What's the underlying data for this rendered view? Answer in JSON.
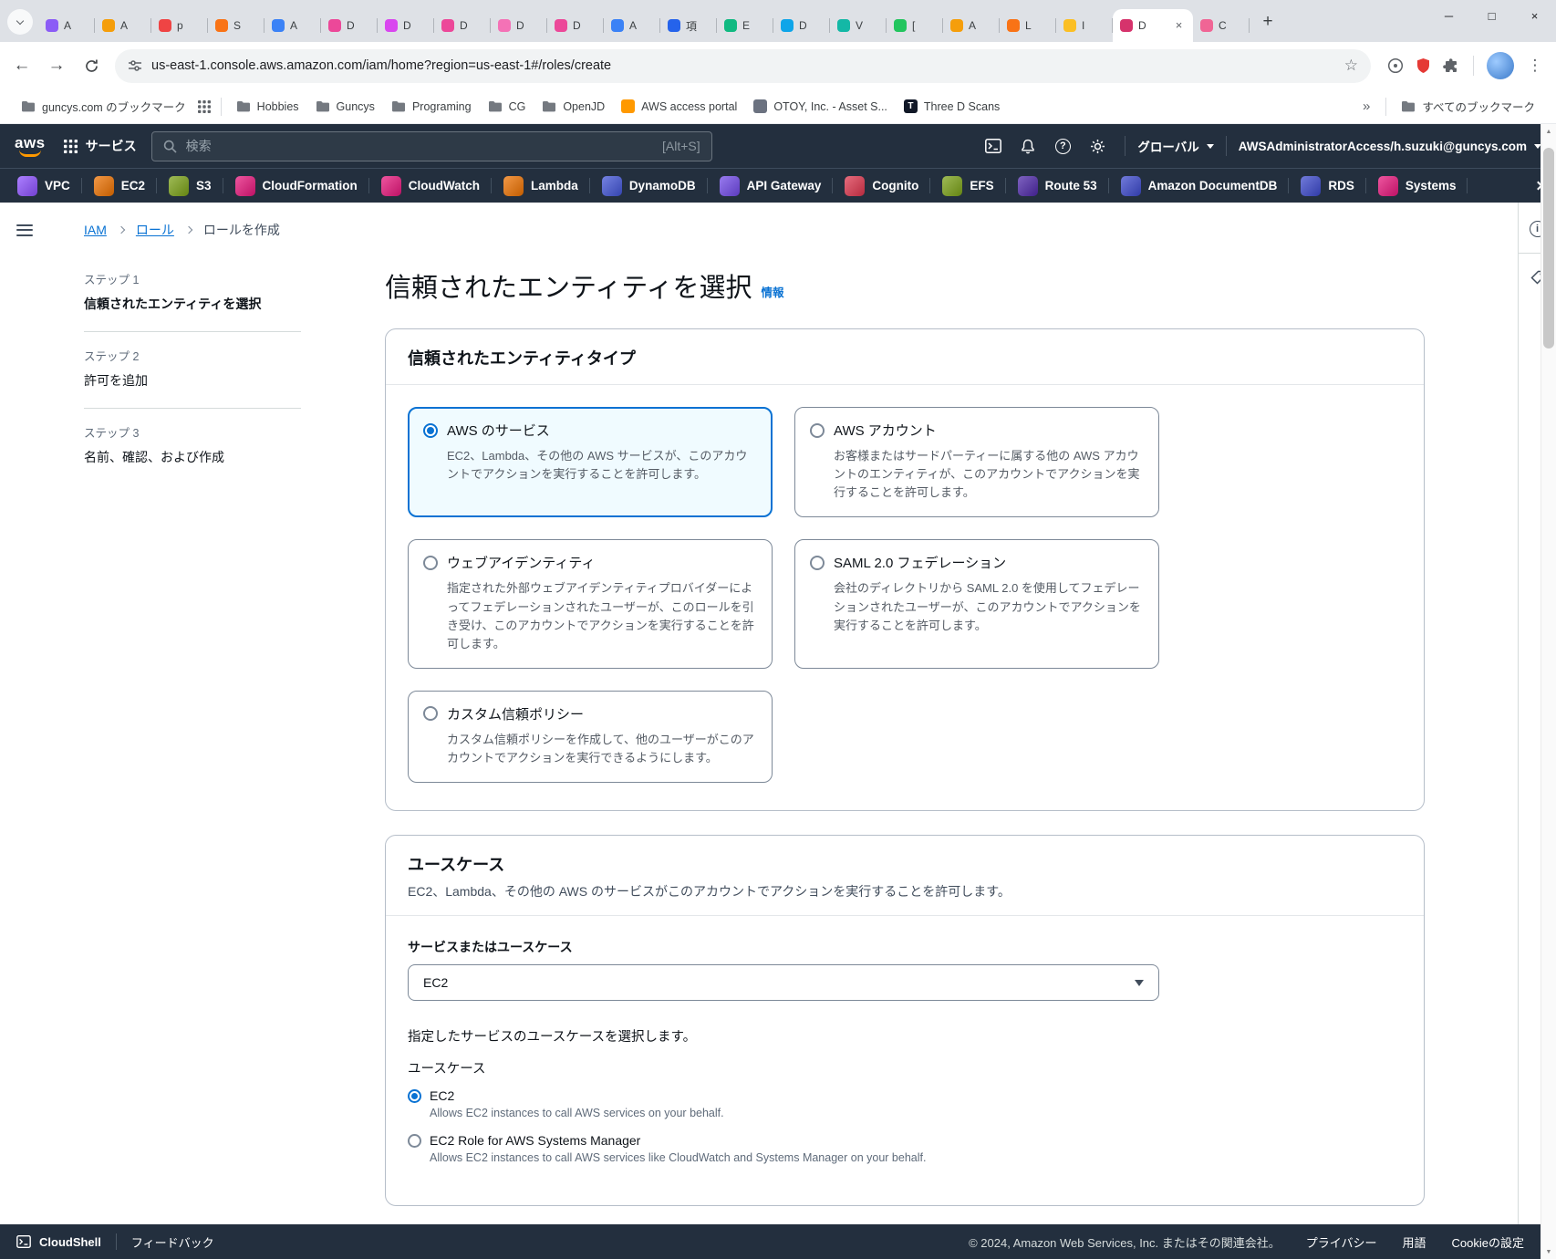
{
  "browser": {
    "tabs": [
      {
        "label": "A",
        "color": "#8b5cf6"
      },
      {
        "label": "A",
        "color": "#f59e0b"
      },
      {
        "label": "p",
        "color": "#ef4444"
      },
      {
        "label": "S",
        "color": "#f97316"
      },
      {
        "label": "A",
        "color": "#3b82f6"
      },
      {
        "label": "D",
        "color": "#ec4899"
      },
      {
        "label": "D",
        "color": "#d946ef"
      },
      {
        "label": "D",
        "color": "#ec4899"
      },
      {
        "label": "D",
        "color": "#f472b6"
      },
      {
        "label": "D",
        "color": "#ec4899"
      },
      {
        "label": "A",
        "color": "#3b82f6"
      },
      {
        "label": "項",
        "color": "#2563eb"
      },
      {
        "label": "E",
        "color": "#10b981"
      },
      {
        "label": "D",
        "color": "#0ea5e9"
      },
      {
        "label": "V",
        "color": "#14b8a6"
      },
      {
        "label": "[",
        "color": "#22c55e"
      },
      {
        "label": "A",
        "color": "#f59e0b"
      },
      {
        "label": "L",
        "color": "#f97316"
      },
      {
        "label": "I",
        "color": "#fbbf24"
      },
      {
        "label": "D",
        "color": "#d6336c",
        "active": true
      },
      {
        "label": "C",
        "color": "#f06595"
      }
    ],
    "url": "us-east-1.console.aws.amazon.com/iam/home?region=us-east-1#/roles/create",
    "bookmark_root": {
      "label": "guncys.com のブックマーク"
    },
    "bookmarks": [
      {
        "label": "Hobbies",
        "folder": true
      },
      {
        "label": "Guncys",
        "folder": true
      },
      {
        "label": "Programing",
        "folder": true
      },
      {
        "label": "CG",
        "folder": true
      },
      {
        "label": "OpenJD",
        "folder": true
      },
      {
        "label": "AWS access portal",
        "color": "#FF9900"
      },
      {
        "label": "OTOY, Inc. - Asset S...",
        "color": "#6b7280"
      },
      {
        "label": "Three D Scans",
        "color": "#111827",
        "letter": "T"
      }
    ],
    "all_bookmarks_label": "すべてのブックマーク"
  },
  "aws_header": {
    "services_label": "サービス",
    "search_placeholder": "検索",
    "search_shortcut": "[Alt+S]",
    "region": "グローバル",
    "account": "AWSAdministratorAccess/h.suzuki@guncys.com"
  },
  "services_bar": {
    "items": [
      {
        "label": "VPC",
        "color": "#8C4FFF"
      },
      {
        "label": "EC2",
        "color": "#ED7100"
      },
      {
        "label": "S3",
        "color": "#7AA116"
      },
      {
        "label": "CloudFormation",
        "color": "#E7157B"
      },
      {
        "label": "CloudWatch",
        "color": "#E7157B"
      },
      {
        "label": "Lambda",
        "color": "#ED7100"
      },
      {
        "label": "DynamoDB",
        "color": "#4053D6"
      },
      {
        "label": "API Gateway",
        "color": "#7048E8"
      },
      {
        "label": "Cognito",
        "color": "#DD344C"
      },
      {
        "label": "EFS",
        "color": "#7AA116"
      },
      {
        "label": "Route 53",
        "color": "#4D27A8"
      },
      {
        "label": "Amazon DocumentDB",
        "color": "#3B48CC"
      },
      {
        "label": "RDS",
        "color": "#3B48CC"
      },
      {
        "label": "Systems",
        "color": "#E7157B"
      }
    ]
  },
  "breadcrumb": {
    "items": [
      "IAM",
      "ロール",
      "ロールを作成"
    ]
  },
  "steps": [
    {
      "step": "ステップ 1",
      "title": "信頼されたエンティティを選択"
    },
    {
      "step": "ステップ 2",
      "title": "許可を追加"
    },
    {
      "step": "ステップ 3",
      "title": "名前、確認、および作成"
    }
  ],
  "page": {
    "title": "信頼されたエンティティを選択",
    "info_link": "情報",
    "entity_card": {
      "title": "信頼されたエンティティタイプ",
      "options": [
        {
          "title": "AWS のサービス",
          "desc": "EC2、Lambda、その他の AWS サービスが、このアカウントでアクションを実行することを許可します。",
          "selected": true
        },
        {
          "title": "AWS アカウント",
          "desc": "お客様またはサードパーティーに属する他の AWS アカウントのエンティティが、このアカウントでアクションを実行することを許可します。"
        },
        {
          "title": "ウェブアイデンティティ",
          "desc": "指定された外部ウェブアイデンティティプロバイダーによってフェデレーションされたユーザーが、このロールを引き受け、このアカウントでアクションを実行することを許可します。"
        },
        {
          "title": "SAML 2.0 フェデレーション",
          "desc": "会社のディレクトリから SAML 2.0 を使用してフェデレーションされたユーザーが、このアカウントでアクションを実行することを許可します。"
        },
        {
          "title": "カスタム信頼ポリシー",
          "desc": "カスタム信頼ポリシーを作成して、他のユーザーがこのアカウントでアクションを実行できるようにします。"
        }
      ]
    },
    "usecase_card": {
      "title": "ユースケース",
      "desc": "EC2、Lambda、その他の AWS のサービスがこのアカウントでアクションを実行することを許可します。",
      "service_label": "サービスまたはユースケース",
      "service_value": "EC2",
      "select_hint": "指定したサービスのユースケースを選択します。",
      "usecase_label": "ユースケース",
      "options": [
        {
          "title": "EC2",
          "desc": "Allows EC2 instances to call AWS services on your behalf.",
          "selected": true
        },
        {
          "title": "EC2 Role for AWS Systems Manager",
          "desc": "Allows EC2 instances to call AWS services like CloudWatch and Systems Manager on your behalf."
        }
      ]
    }
  },
  "footer": {
    "cloudshell": "CloudShell",
    "feedback": "フィードバック",
    "copyright": "© 2024, Amazon Web Services, Inc. またはその関連会社。",
    "privacy": "プライバシー",
    "terms": "用語",
    "cookie": "Cookieの設定"
  }
}
